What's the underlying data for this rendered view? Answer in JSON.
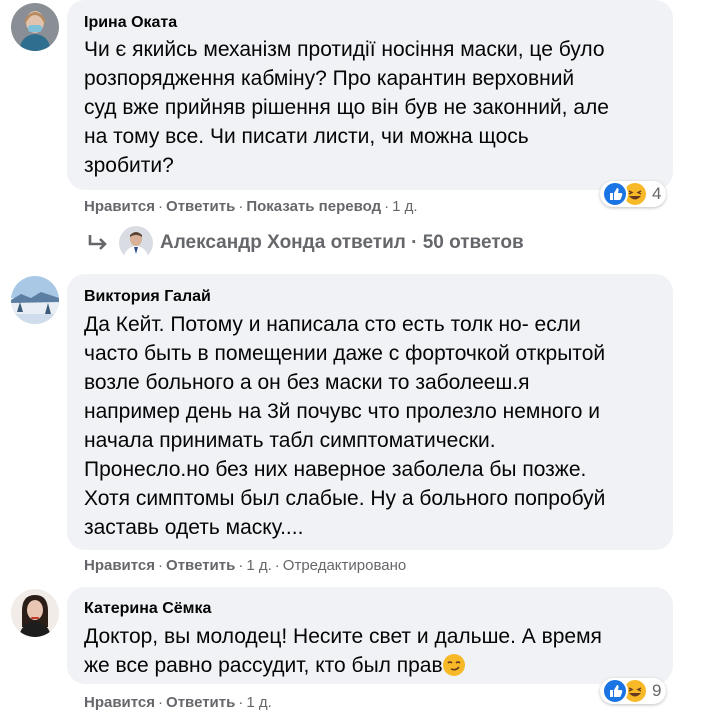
{
  "comments": [
    {
      "author": "Ірина Оката",
      "lines": [
        "Чи є якийсь механізм протидії носіння маски, це було",
        "розпорядження кабміну? Про карантин верховний",
        "суд вже прийняв рішення що він був не законний, але",
        "на тому все. Чи писати листи, чи можна щось",
        "зробити?"
      ],
      "like": "Нравится",
      "reply": "Ответить",
      "translate": "Показать перевод",
      "time": "1 д.",
      "reaction_count": "4"
    },
    {
      "author": "Виктория Галай",
      "lines": [
        "Да Кейт. Потому и написала сто есть толк но- если",
        "часто быть в помещении даже с форточкой открытой",
        "возле больного а он без маски то заболееш.я",
        "например день на 3й почувс что пролезло немного и",
        "начала принимать табл симптоматически.",
        "Пронесло.но без них наверное заболела бы позже.",
        "Хотя симптомы был слабые. Ну а больного попробуй",
        "заставь одеть маску...."
      ],
      "like": "Нравится",
      "reply": "Ответить",
      "time": "1 д.",
      "edited": "Отредактировано"
    },
    {
      "author": "Катерина Сёмка",
      "lines": [
        "Доктор, вы молодец! Несите свет и дальше. А время",
        "же все равно рассудит, кто был прав"
      ],
      "like": "Нравится",
      "reply": "Ответить",
      "time": "1 д.",
      "reaction_count": "9"
    }
  ],
  "reply_thread": {
    "author": "Александр Хонда",
    "text": "ответил · 50 ответов"
  },
  "colors": {
    "bubble": "#f0f2f5",
    "like_reaction": "#1b74e4",
    "haha_reaction": "#f7b928",
    "meta_text": "#65676b"
  },
  "icons": [
    "like-reaction-icon",
    "haha-reaction-icon",
    "reply-arrow-icon",
    "smirk-emoji-icon"
  ]
}
